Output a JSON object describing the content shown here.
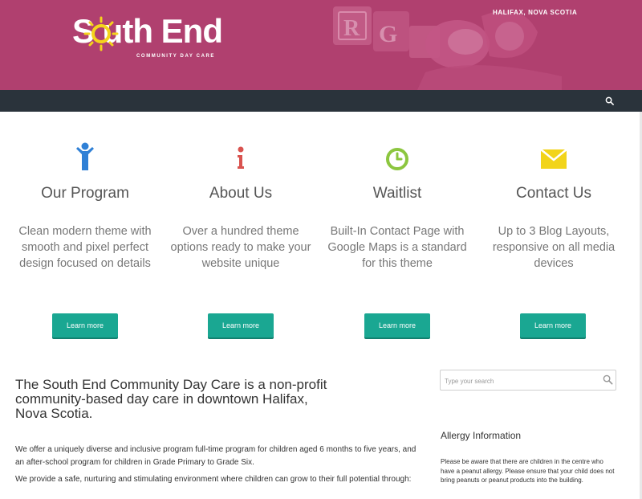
{
  "header": {
    "logo_text": "S  uth End",
    "logo_subtitle": "COMMUNITY DAY CARE",
    "location": "HALIFAX, NOVA SCOTIA",
    "background_color": "#b0406f"
  },
  "nav": {
    "background_color": "#2a333b",
    "search_icon": "search-icon"
  },
  "features": [
    {
      "icon": "person-icon",
      "icon_color": "#2f80d6",
      "title": "Our Program",
      "text": "Clean modern theme with smooth and pixel perfect design focused on details",
      "button": "Learn more"
    },
    {
      "icon": "info-icon",
      "icon_color": "#d9534f",
      "title": "About Us",
      "text": "Over a hundred theme options ready to make your website unique",
      "button": "Learn more"
    },
    {
      "icon": "clock-icon",
      "icon_color": "#8cc63f",
      "title": "Waitlist",
      "text": "Built-In Contact Page with Google Maps is a standard for this theme",
      "button": "Learn more"
    },
    {
      "icon": "envelope-icon",
      "icon_color": "#f2d41a",
      "title": "Contact Us",
      "text": "Up to 3 Blog Layouts, responsive on all media devices",
      "button": "Learn more"
    }
  ],
  "button_color": "#1aa792",
  "main": {
    "intro": "The South End Community Day Care is a non-profit community-based day care in downtown Halifax, Nova Scotia.",
    "paragraphs": [
      "We offer a uniquely diverse and inclusive program full-time program for children aged 6 months to five years, and an after-school program for children in Grade Primary to Grade Six.",
      "We provide a safe, nurturing and stimulating environment where children can grow to their full potential through:"
    ]
  },
  "sidebar": {
    "search_placeholder": "Type your search",
    "allergy_title": "Allergy Information",
    "allergy_text": "Please be aware that there are children in the centre who have a peanut allergy. Please ensure that your child does not bring peanuts or peanut products into the building."
  }
}
